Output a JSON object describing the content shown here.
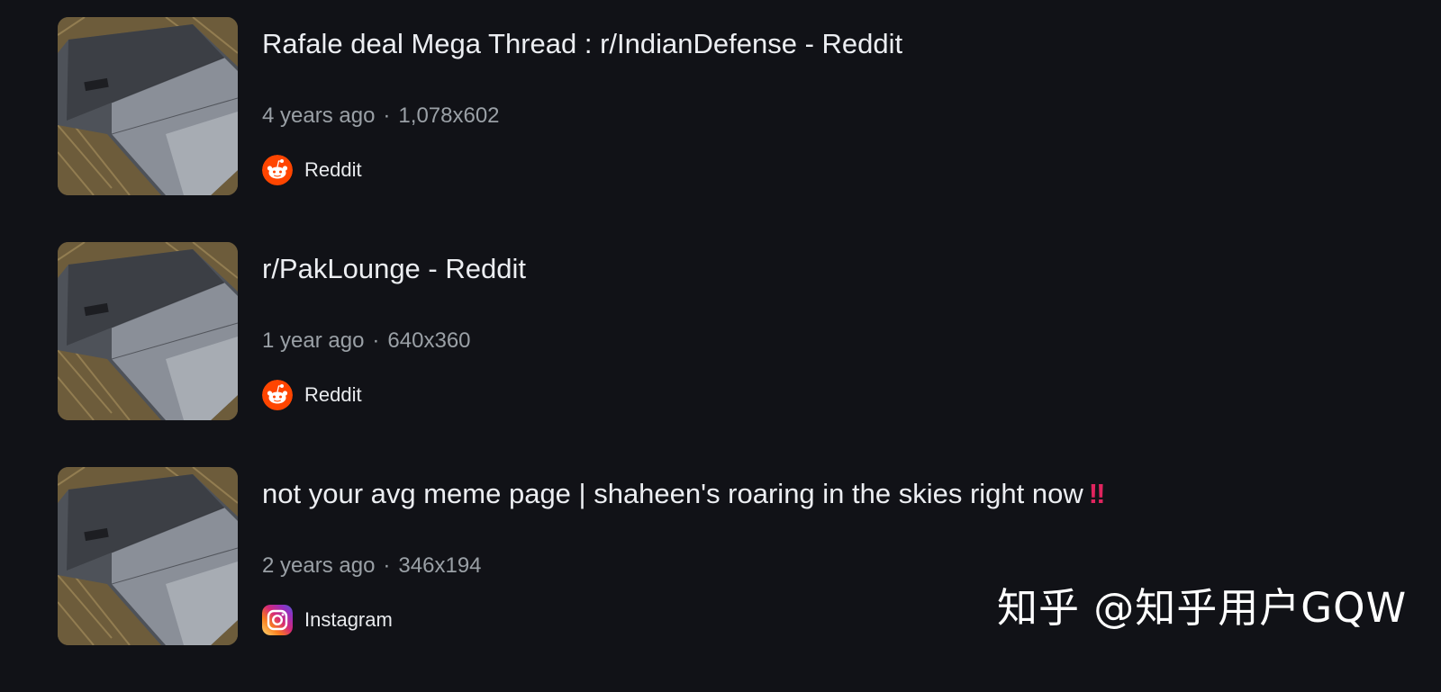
{
  "results": [
    {
      "title": "Rafale deal Mega Thread : r/IndianDefense - Reddit",
      "age": "4 years ago",
      "dimensions": "1,078x602",
      "source": "Reddit",
      "source_icon": "reddit-icon"
    },
    {
      "title": "r/PakLounge - Reddit",
      "age": "1 year ago",
      "dimensions": "640x360",
      "source": "Reddit",
      "source_icon": "reddit-icon"
    },
    {
      "title": "not your avg meme page | shaheen's roaring in the skies right now",
      "title_emoji": "‼",
      "age": "2 years ago",
      "dimensions": "346x194",
      "source": "Instagram",
      "source_icon": "instagram-icon"
    }
  ],
  "separator": "·",
  "watermark": "知乎 @知乎用户GQW",
  "colors": {
    "background": "#111217",
    "title": "#eceef2",
    "meta": "#9aa0a6",
    "reddit": "#ff4500",
    "emoji": "#e0245e"
  }
}
